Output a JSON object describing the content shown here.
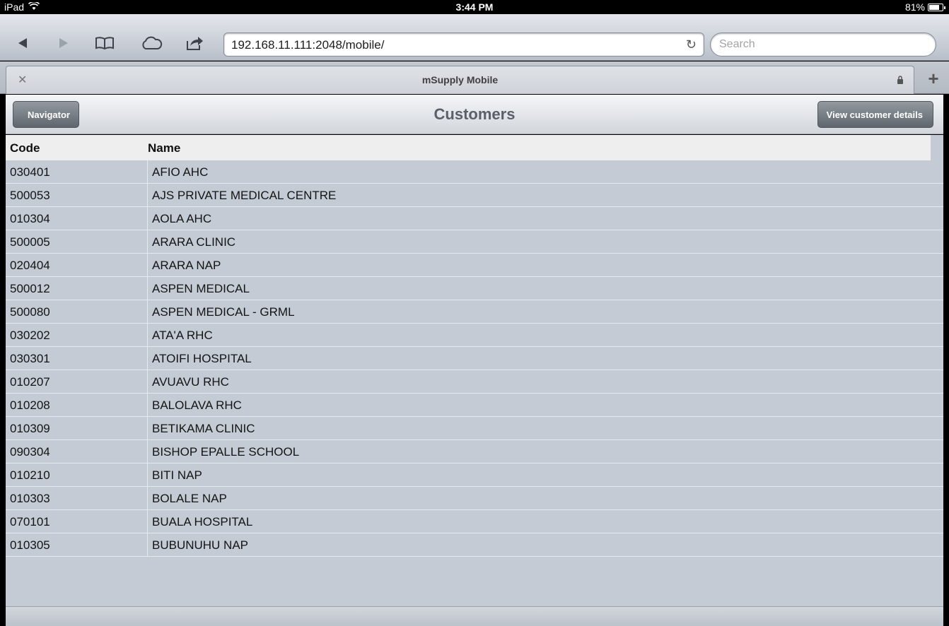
{
  "status_bar": {
    "device": "iPad",
    "time": "3:44 PM",
    "battery": "81%",
    "battery_level": 0.81
  },
  "browser": {
    "url": "192.168.11.111:2048/mobile/",
    "search_placeholder": "Search",
    "tab_title": "mSupply Mobile"
  },
  "header": {
    "back_label": "Navigator",
    "title": "Customers",
    "action_label": "View customer details"
  },
  "table": {
    "columns": [
      "Code",
      "Name"
    ],
    "rows": [
      {
        "code": "030401",
        "name": "AFIO AHC"
      },
      {
        "code": "500053",
        "name": "AJS PRIVATE MEDICAL CENTRE"
      },
      {
        "code": "010304",
        "name": "AOLA AHC"
      },
      {
        "code": "500005",
        "name": "ARARA CLINIC"
      },
      {
        "code": "020404",
        "name": "ARARA NAP"
      },
      {
        "code": "500012",
        "name": "ASPEN MEDICAL"
      },
      {
        "code": "500080",
        "name": "ASPEN MEDICAL - GRML"
      },
      {
        "code": "030202",
        "name": "ATA'A RHC"
      },
      {
        "code": "030301",
        "name": "ATOIFI HOSPITAL"
      },
      {
        "code": "010207",
        "name": "AVUAVU RHC"
      },
      {
        "code": "010208",
        "name": "BALOLAVA RHC"
      },
      {
        "code": "010309",
        "name": "BETIKAMA CLINIC"
      },
      {
        "code": "090304",
        "name": "BISHOP EPALLE SCHOOL"
      },
      {
        "code": "010210",
        "name": "BITI NAP"
      },
      {
        "code": "010303",
        "name": "BOLALE NAP"
      },
      {
        "code": "070101",
        "name": "BUALA HOSPITAL"
      },
      {
        "code": "010305",
        "name": "BUBUNUHU NAP"
      }
    ]
  }
}
